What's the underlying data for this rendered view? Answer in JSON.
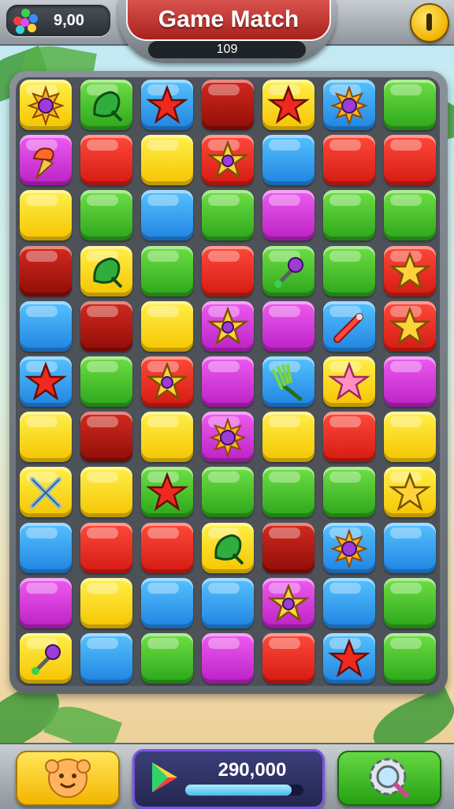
{
  "header": {
    "title": "Game Match",
    "level": "109",
    "counter_value": "9,00",
    "counter_icon": "gem-cluster-icon",
    "pause_icon": "pause-icon"
  },
  "colors": {
    "yellow": "#f5c400",
    "green": "#2ba51a",
    "blue": "#1f83e0",
    "red": "#d41a12",
    "darkred": "#8f0d08",
    "magenta": "#bb20c4"
  },
  "board": {
    "columns": 7,
    "rows": 11,
    "tiles": [
      [
        "yellow:sun-gem",
        "green:leaf",
        "blue:red-star",
        "darkred",
        "yellow:red-star",
        "blue:sun-gem",
        "green"
      ],
      [
        "magenta:ice-cream",
        "red",
        "yellow",
        "red:star-orb",
        "blue",
        "red",
        "red"
      ],
      [
        "yellow",
        "green",
        "blue",
        "green",
        "magenta",
        "green",
        "green"
      ],
      [
        "darkred",
        "yellow:leaf",
        "green",
        "red",
        "green:wand",
        "green",
        "red:yellow-star"
      ],
      [
        "blue",
        "darkred",
        "yellow",
        "magenta:star-orb",
        "magenta",
        "blue:rocket",
        "red:yellow-star"
      ],
      [
        "blue:red-star",
        "green",
        "red:star-orb",
        "magenta",
        "blue:fork",
        "yellow:pink-star",
        "magenta"
      ],
      [
        "yellow",
        "darkred",
        "yellow",
        "magenta:sun-gem",
        "yellow",
        "red",
        "yellow"
      ],
      [
        "yellow:crossed-swords",
        "yellow",
        "green:red-star",
        "green",
        "green",
        "green",
        "yellow:yellow-star"
      ],
      [
        "blue",
        "red",
        "red",
        "yellow:leaf",
        "darkred",
        "blue:sun-gem",
        "blue"
      ],
      [
        "magenta",
        "yellow",
        "blue",
        "blue",
        "magenta:star-orb",
        "blue",
        "green"
      ],
      [
        "yellow:wand",
        "blue",
        "green",
        "magenta",
        "red",
        "blue:red-star",
        "green"
      ]
    ]
  },
  "footer": {
    "score": "290,000",
    "score_progress": 0.9,
    "left_button_icon": "smiley-face-icon",
    "right_button_icon": "gear-magnifier-icon",
    "play_icon": "play-store-icon"
  }
}
